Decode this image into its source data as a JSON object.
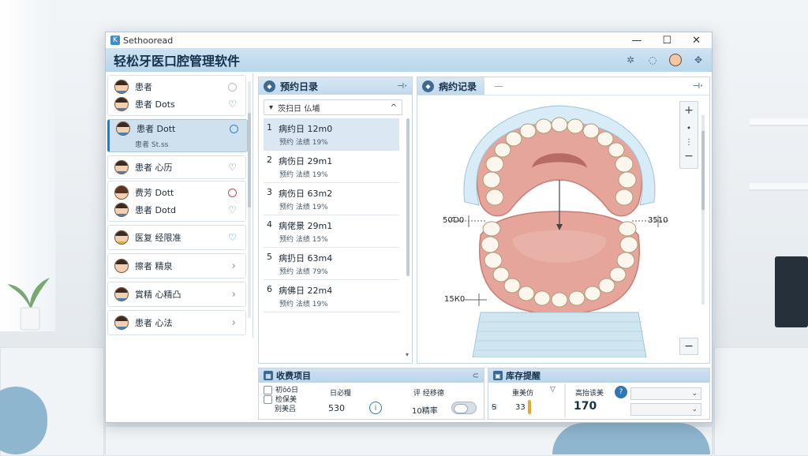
{
  "window": {
    "title": "Sethooread",
    "controls": [
      "—",
      "☐",
      "✕"
    ]
  },
  "header": {
    "app_name": "轻松牙医口腔管理软件",
    "icons": [
      "settings-icon",
      "help-icon",
      "user-avatar-icon",
      "gear-icon"
    ]
  },
  "patients": [
    {
      "name": "患者",
      "sub": "",
      "status": "grey-ring",
      "group": 0
    },
    {
      "name": "患者 Dots",
      "sub": "",
      "status": "green-heart",
      "group": 0
    },
    {
      "name": "患者 Dott",
      "sub": "患者 St.ss",
      "status": "blue-ring",
      "group": 1,
      "selected": true
    },
    {
      "name": "患者 心历",
      "sub": "",
      "status": "green-heart",
      "group": 2
    },
    {
      "name": "费芳 Dott",
      "sub": "",
      "status": "red-ring",
      "group": 3
    },
    {
      "name": "患者 Dotd",
      "sub": "",
      "status": "green-heart",
      "group": 3
    },
    {
      "name": "医复 经限准",
      "sub": "",
      "status": "blue-heart",
      "group": 4
    },
    {
      "name": "擦者 精泉",
      "sub": "",
      "status": "chevron",
      "group": 5
    },
    {
      "name": "賞精 心精凸",
      "sub": "",
      "status": "chevron",
      "group": 6
    },
    {
      "name": "患者 心法",
      "sub": "",
      "status": "chevron",
      "group": 7
    }
  ],
  "appointments": {
    "title": "预约日录",
    "pin": "⊣·",
    "filter": "茨扫日 仏埔",
    "rows": [
      {
        "num": "1",
        "text": "病约日 12m0",
        "sub": "预约 法绩 19%",
        "selected": true
      },
      {
        "num": "2",
        "text": "病伤日 29m1",
        "sub": "预约 法绩 19%"
      },
      {
        "num": "3",
        "text": "病伤日 63m2",
        "sub": "预约 法绩 19%"
      },
      {
        "num": "4",
        "text": "病佬景 29m1",
        "sub": "预约 法绩 15%"
      },
      {
        "num": "5",
        "text": "病扔日 63m4",
        "sub": "预约 法绩 79%"
      },
      {
        "num": "6",
        "text": "病佛日 22m4",
        "sub": "预约 法绩 19%"
      }
    ]
  },
  "record": {
    "title": "病约记录",
    "tab2": "—",
    "pin": "⊣·",
    "zoom": {
      "plus": "+",
      "arrow": "⬩",
      "dots": "⋮",
      "minus": "−"
    },
    "measure_left": "50Ɗ0",
    "measure_right": "3510",
    "measure_bottom": "15К0"
  },
  "charges": {
    "title": "收费项目",
    "pin": "⊂",
    "item1": "初ǒǒ日",
    "item2": "检保美",
    "item3": "别美吕",
    "col2_label": "日必糧",
    "col2_value": "530",
    "col3_label": "评 经移德",
    "col3_value": "10精率"
  },
  "inventory": {
    "title": "库存提醒",
    "row_label": "重美仿",
    "row_value": "33",
    "count_label": "高抬该美",
    "count_value": "170",
    "left_mark": "Ꞩ"
  }
}
